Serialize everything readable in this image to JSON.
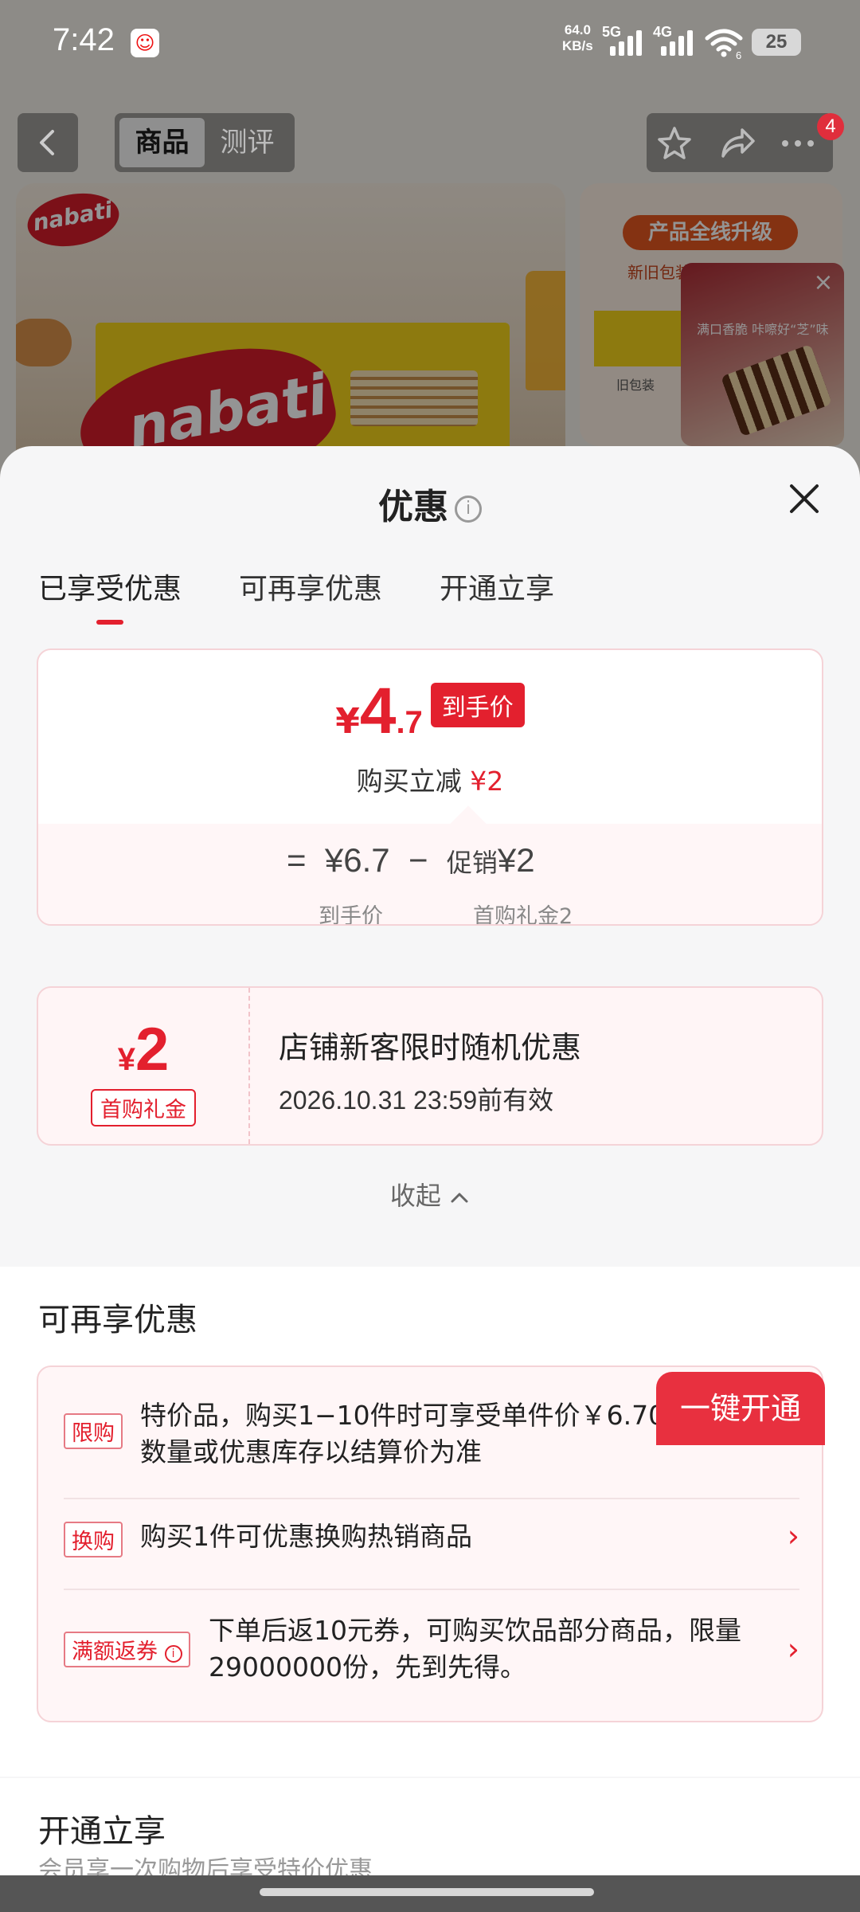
{
  "status_bar": {
    "time": "7:42",
    "net_speed_value": "64.0",
    "net_speed_unit": "KB/s",
    "sim1": "5G",
    "sim2": "4G",
    "wifi_level": "6",
    "battery": "25"
  },
  "nav": {
    "tabs": [
      "商品",
      "测评"
    ],
    "active_tab": "商品",
    "badge_count": "4"
  },
  "background": {
    "brand": "nabati",
    "promo_pill": "产品全线升级",
    "promo_sub": "新旧包装随机发货",
    "pack_caption": "旧包装",
    "video_caption": "满口香脆 咔嚓好“芝”味"
  },
  "sheet": {
    "title": "优惠",
    "tabs": [
      "已享受优惠",
      "可再享优惠",
      "开通立享"
    ],
    "active_tab_index": 0,
    "price": {
      "currency": "¥",
      "integer": "4",
      "decimal": ".7",
      "tag": "到手价",
      "reduce_label": "购买立减",
      "reduce_amount": "¥2",
      "calc_eq": "=",
      "calc_base": "¥6.7",
      "calc_minus": "−",
      "calc_promo_label": "促销",
      "calc_promo_amount": "¥2",
      "caption_base": "到手价",
      "caption_promo": "首购礼金2"
    },
    "coupon": {
      "currency": "¥",
      "amount": "2",
      "label": "首购礼金",
      "title": "店铺新客限时随机优惠",
      "valid": "2026.10.31 23:59前有效"
    },
    "collapse_label": "收起",
    "more_section": {
      "title": "可再享优惠",
      "rows": [
        {
          "badge": "限购",
          "text": "特价品，购买1−10件时可享受单件价￥6.70，超出数量或优惠库存以结算价为准",
          "arrow": false
        },
        {
          "badge": "换购",
          "text": "购买1件可优惠换购热销商品",
          "arrow": true
        },
        {
          "badge": "满额返券",
          "text": "下单后返10元券，可购买饮品部分商品，限量29000000份，先到先得。",
          "arrow": true
        }
      ]
    },
    "open_section": {
      "title": "开通立享",
      "button": "一键开通",
      "subtitle": "会员享一次购物后享受特价优惠"
    }
  },
  "colors": {
    "accent_red": "#e3202e",
    "card_border": "#f5d3d7",
    "card_bg": "#fff6f7"
  }
}
